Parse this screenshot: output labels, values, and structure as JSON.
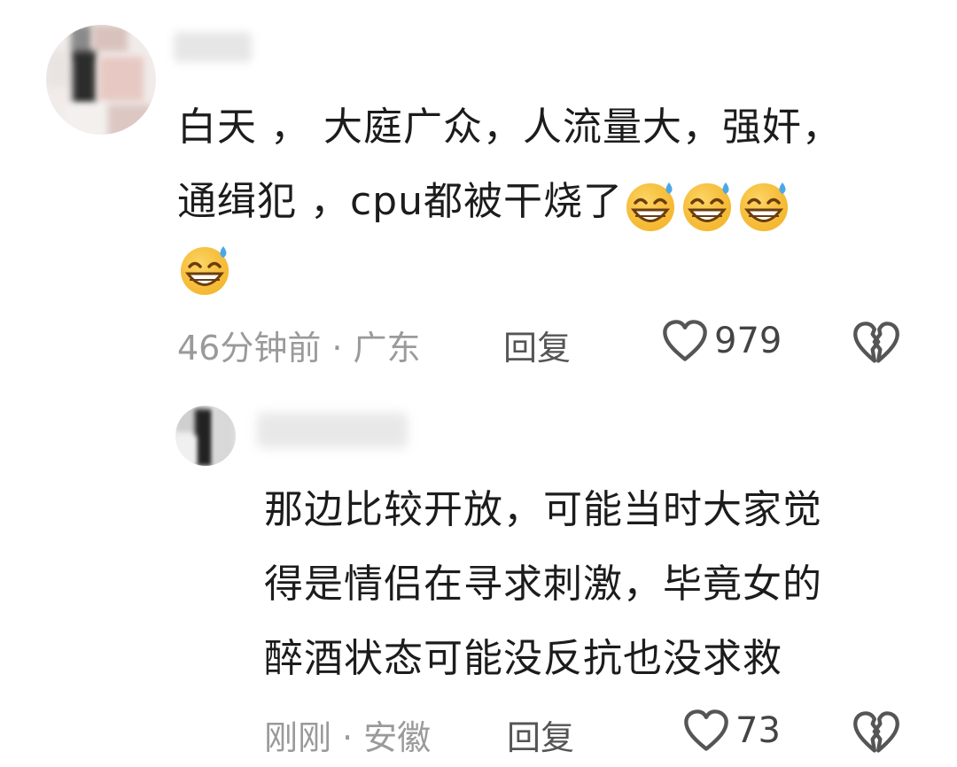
{
  "comment": {
    "text_line1": "白天  ，  大庭广众，人流量大，强奸，",
    "text_line2": "通缉犯  ，cpu都被干烧了",
    "emojis": [
      "sweat-smile-emoji",
      "sweat-smile-emoji",
      "sweat-smile-emoji",
      "sweat-smile-emoji"
    ],
    "time": "46分钟前",
    "separator": "·",
    "location": "广东",
    "reply_label": "回复",
    "like_count": "979"
  },
  "reply": {
    "text_line1": "那边比较开放，可能当时大家觉",
    "text_line2": "得是情侣在寻求刺激，毕竟女的",
    "text_line3": "醉酒状态可能没反抗也没求救",
    "time": "刚刚",
    "separator": "·",
    "location": "安徽",
    "reply_label": "回复",
    "like_count": "73"
  },
  "colors": {
    "text": "#1c1c1c",
    "meta": "#9a9a9a",
    "icon_stroke": "#555555",
    "emoji_face": "#f7c13a"
  }
}
